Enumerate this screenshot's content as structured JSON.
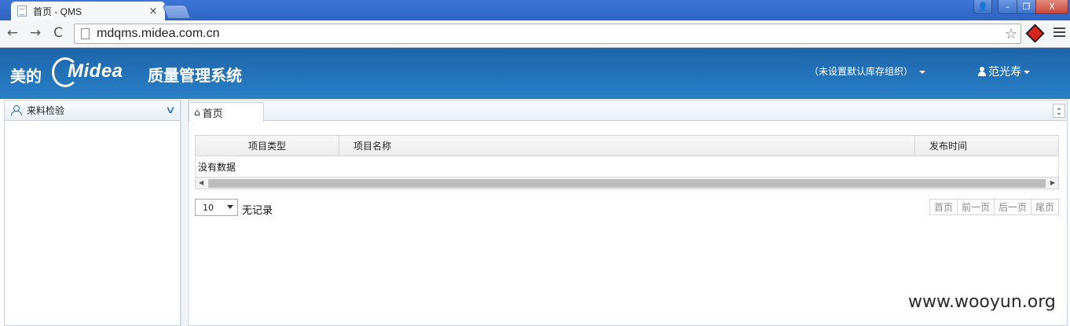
{
  "browser": {
    "tab_title": "首页 - QMS",
    "tab_close": "×",
    "url": "mdqms.midea.com.cn",
    "window_controls": {
      "user": "👤",
      "minimize": "–",
      "maximize": "❐",
      "close": "X"
    },
    "nav_icons": {
      "back": "←",
      "forward": "→",
      "reload": "C",
      "star": "☆"
    }
  },
  "header": {
    "brand_cn": "美的",
    "brand_en": "Midea",
    "app_title": "质量管理系统",
    "org_selector": "（未设置默认库存组织）",
    "user_name": "范光寿",
    "colors": {
      "header_bg": "#1d64aa",
      "header_bg_bottom": "#2a80c6"
    }
  },
  "sidebar": {
    "section_label": "来料检验",
    "chevron": "∨"
  },
  "main": {
    "tab_label": "首页",
    "home_icon": "⌂",
    "collapse_icon": "»",
    "grid": {
      "columns": [
        "项目类型",
        "项目名称",
        "发布时间"
      ],
      "empty_text": "没有数据"
    },
    "pager": {
      "page_size": "10",
      "record_info": "无记录",
      "buttons": [
        "首页",
        "前一页",
        "后一页",
        "尾页"
      ]
    }
  },
  "watermark": "www.wooyun.org"
}
